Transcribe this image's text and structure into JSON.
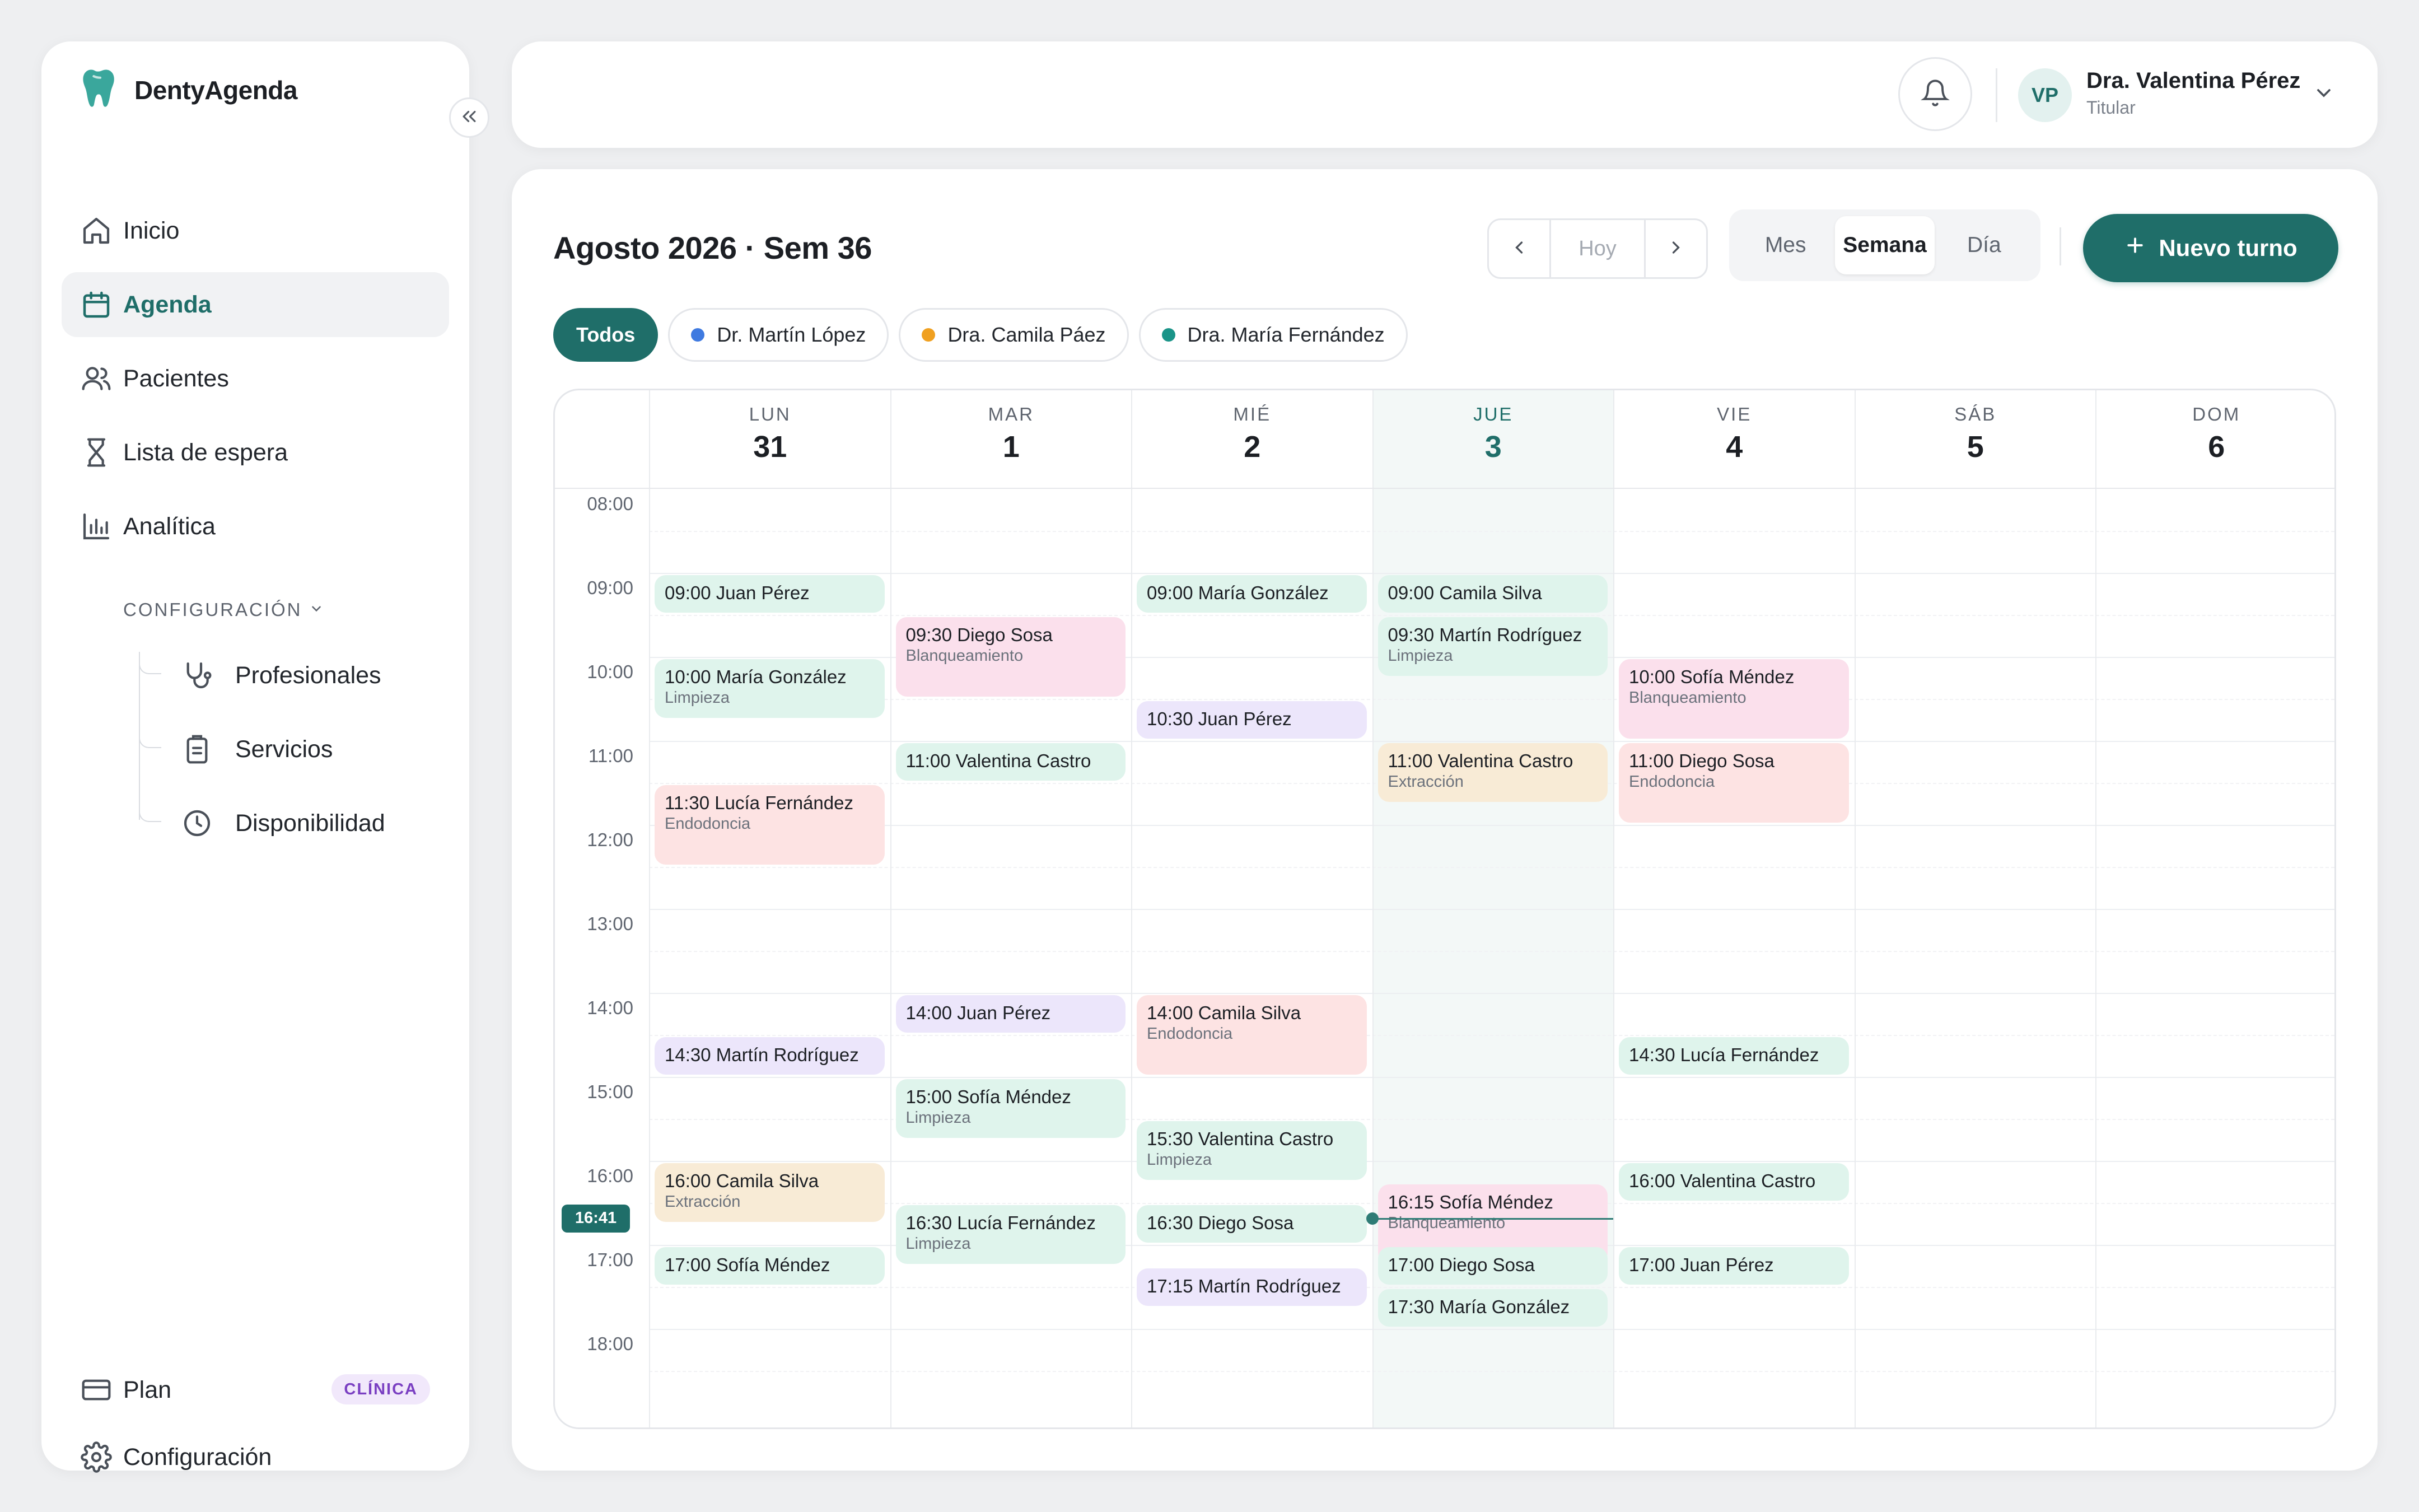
{
  "app": {
    "name": "DentyAgenda"
  },
  "sidebar": {
    "nav": [
      {
        "label": "Inicio",
        "icon": "home-icon"
      },
      {
        "label": "Agenda",
        "icon": "calendar-icon",
        "active": true
      },
      {
        "label": "Pacientes",
        "icon": "users-icon"
      },
      {
        "label": "Lista de espera",
        "icon": "hourglass-icon"
      },
      {
        "label": "Analítica",
        "icon": "bar-chart-icon"
      }
    ],
    "config_header": "CONFIGURACIÓN",
    "config_items": [
      {
        "label": "Profesionales",
        "icon": "stethoscope-icon"
      },
      {
        "label": "Servicios",
        "icon": "clipboard-icon"
      },
      {
        "label": "Disponibilidad",
        "icon": "clock-icon"
      }
    ],
    "bottom": {
      "plan_label": "Plan",
      "plan_badge": "CLÍNICA",
      "settings_label": "Configuración"
    }
  },
  "topbar": {
    "user_initials": "VP",
    "user_name": "Dra. Valentina Pérez",
    "user_role": "Titular"
  },
  "calendar": {
    "title": "Agosto 2026 · Sem 36",
    "today_label": "Hoy",
    "views": [
      "Mes",
      "Semana",
      "Día"
    ],
    "active_view": "Semana",
    "new_button": "Nuevo turno",
    "filters": [
      {
        "label": "Todos",
        "active": true
      },
      {
        "label": "Dr. Martín López",
        "color": "#3f7ae0"
      },
      {
        "label": "Dra. Camila Páez",
        "color": "#f0a020"
      },
      {
        "label": "Dra. María Fernández",
        "color": "#1a9488"
      }
    ],
    "days": [
      {
        "dow": "LUN",
        "num": "31"
      },
      {
        "dow": "MAR",
        "num": "1"
      },
      {
        "dow": "MIÉ",
        "num": "2"
      },
      {
        "dow": "JUE",
        "num": "3",
        "today": true
      },
      {
        "dow": "VIE",
        "num": "4"
      },
      {
        "dow": "SÁB",
        "num": "5"
      },
      {
        "dow": "DOM",
        "num": "6"
      }
    ],
    "hours": [
      "08:00",
      "09:00",
      "10:00",
      "11:00",
      "12:00",
      "13:00",
      "14:00",
      "15:00",
      "16:00",
      "17:00",
      "18:00"
    ],
    "now_label": "16:41",
    "now_minutes": 1001,
    "events": [
      {
        "day": 0,
        "start": "09:00",
        "end": "09:30",
        "title": "09:00 Juan Pérez",
        "color": "mint"
      },
      {
        "day": 0,
        "start": "10:00",
        "end": "10:45",
        "title": "10:00 María González",
        "sub": "Limpieza",
        "color": "mint"
      },
      {
        "day": 0,
        "start": "11:30",
        "end": "12:30",
        "title": "11:30 Lucía Fernández",
        "sub": "Endodoncia",
        "color": "rose"
      },
      {
        "day": 0,
        "start": "14:30",
        "end": "15:00",
        "title": "14:30 Martín Rodríguez",
        "color": "lav"
      },
      {
        "day": 0,
        "start": "16:00",
        "end": "16:45",
        "title": "16:00 Camila Silva",
        "sub": "Extracción",
        "color": "sand"
      },
      {
        "day": 0,
        "start": "17:00",
        "end": "17:30",
        "title": "17:00 Sofía Méndez",
        "color": "mint"
      },
      {
        "day": 1,
        "start": "09:30",
        "end": "10:30",
        "title": "09:30 Diego Sosa",
        "sub": "Blanqueamiento",
        "color": "pink"
      },
      {
        "day": 1,
        "start": "11:00",
        "end": "11:30",
        "title": "11:00 Valentina Castro",
        "color": "mint"
      },
      {
        "day": 1,
        "start": "14:00",
        "end": "14:30",
        "title": "14:00 Juan Pérez",
        "color": "lav"
      },
      {
        "day": 1,
        "start": "15:00",
        "end": "15:45",
        "title": "15:00 Sofía Méndez",
        "sub": "Limpieza",
        "color": "mint"
      },
      {
        "day": 1,
        "start": "16:30",
        "end": "17:15",
        "title": "16:30 Lucía Fernández",
        "sub": "Limpieza",
        "color": "mint"
      },
      {
        "day": 2,
        "start": "09:00",
        "end": "09:30",
        "title": "09:00 María González",
        "color": "mint"
      },
      {
        "day": 2,
        "start": "10:30",
        "end": "11:00",
        "title": "10:30 Juan Pérez",
        "color": "lav"
      },
      {
        "day": 2,
        "start": "14:00",
        "end": "15:00",
        "title": "14:00 Camila Silva",
        "sub": "Endodoncia",
        "color": "rose"
      },
      {
        "day": 2,
        "start": "15:30",
        "end": "16:15",
        "title": "15:30 Valentina Castro",
        "sub": "Limpieza",
        "color": "mint"
      },
      {
        "day": 2,
        "start": "16:30",
        "end": "17:00",
        "title": "16:30 Diego Sosa",
        "color": "mint"
      },
      {
        "day": 2,
        "start": "17:15",
        "end": "17:45",
        "title": "17:15 Martín Rodríguez",
        "color": "lav"
      },
      {
        "day": 3,
        "start": "09:00",
        "end": "09:30",
        "title": "09:00 Camila Silva",
        "color": "mint"
      },
      {
        "day": 3,
        "start": "09:30",
        "end": "10:15",
        "title": "09:30 Martín Rodríguez",
        "sub": "Limpieza",
        "color": "mint"
      },
      {
        "day": 3,
        "start": "11:00",
        "end": "11:45",
        "title": "11:00 Valentina Castro",
        "sub": "Extracción",
        "color": "sand"
      },
      {
        "day": 3,
        "start": "16:15",
        "end": "17:15",
        "title": "16:15 Sofía Méndez",
        "sub": "Blanqueamiento",
        "color": "pink"
      },
      {
        "day": 3,
        "start": "17:00",
        "end": "17:30",
        "title": "17:00 Diego Sosa",
        "color": "mint"
      },
      {
        "day": 3,
        "start": "17:30",
        "end": "18:00",
        "title": "17:30 María González",
        "color": "mint"
      },
      {
        "day": 4,
        "start": "10:00",
        "end": "11:00",
        "title": "10:00 Sofía Méndez",
        "sub": "Blanqueamiento",
        "color": "pink"
      },
      {
        "day": 4,
        "start": "11:00",
        "end": "12:00",
        "title": "11:00 Diego Sosa",
        "sub": "Endodoncia",
        "color": "rose"
      },
      {
        "day": 4,
        "start": "14:30",
        "end": "15:00",
        "title": "14:30 Lucía Fernández",
        "color": "mint"
      },
      {
        "day": 4,
        "start": "16:00",
        "end": "16:30",
        "title": "16:00 Valentina Castro",
        "color": "mint"
      },
      {
        "day": 4,
        "start": "17:00",
        "end": "17:30",
        "title": "17:00 Juan Pérez",
        "color": "mint"
      }
    ]
  },
  "colors": {
    "brand": "#1f6e69",
    "accent_soft": "#e3f1ef"
  }
}
